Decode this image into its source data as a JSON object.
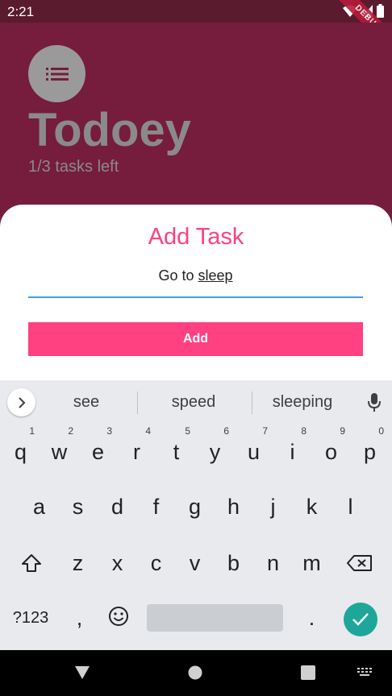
{
  "status_bar": {
    "time": "2:21",
    "debug_label": "DEBUG"
  },
  "app": {
    "title": "Todoey",
    "tasks_left": "1/3 tasks left"
  },
  "sheet": {
    "title": "Add Task",
    "input_prefix": "Go to ",
    "input_word": "sleep",
    "add_label": "Add"
  },
  "keyboard": {
    "suggestions": [
      "see",
      "speed",
      "sleeping"
    ],
    "row1": [
      {
        "key": "q",
        "hint": "1"
      },
      {
        "key": "w",
        "hint": "2"
      },
      {
        "key": "e",
        "hint": "3"
      },
      {
        "key": "r",
        "hint": "4"
      },
      {
        "key": "t",
        "hint": "5"
      },
      {
        "key": "y",
        "hint": "6"
      },
      {
        "key": "u",
        "hint": "7"
      },
      {
        "key": "i",
        "hint": "8"
      },
      {
        "key": "o",
        "hint": "9"
      },
      {
        "key": "p",
        "hint": "0"
      }
    ],
    "row2": [
      "a",
      "s",
      "d",
      "f",
      "g",
      "h",
      "j",
      "k",
      "l"
    ],
    "row3": [
      "z",
      "x",
      "c",
      "v",
      "b",
      "n",
      "m"
    ],
    "symbols_label": "?123",
    "comma": ",",
    "period": "."
  },
  "colors": {
    "accent": "#ff4081",
    "app_bg": "#761c3c",
    "input_underline": "#3f9fe8",
    "enter_key": "#1ea69a"
  }
}
